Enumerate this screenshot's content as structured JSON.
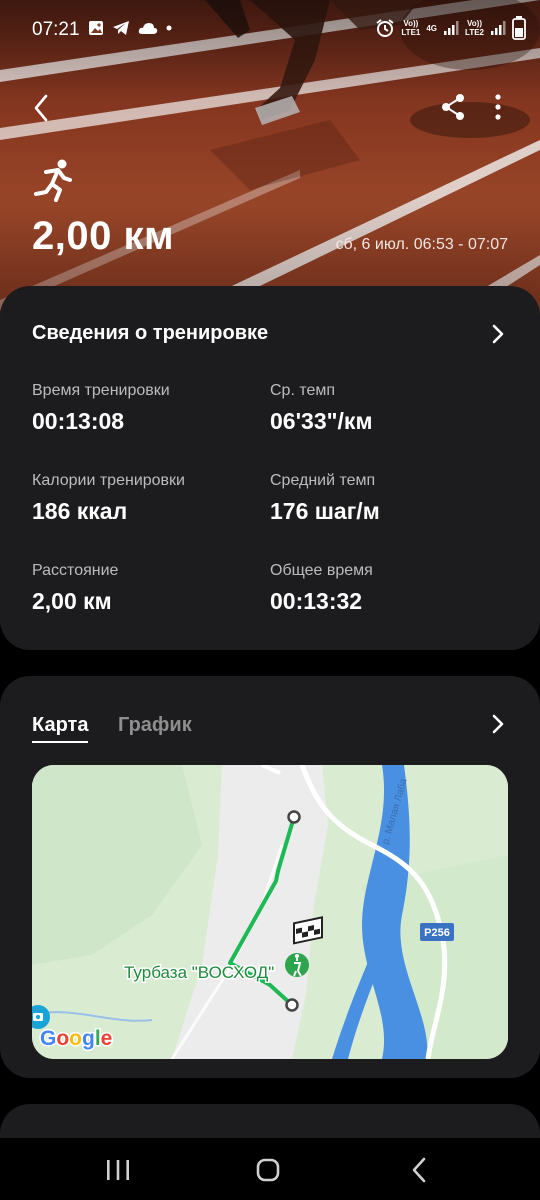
{
  "status_bar": {
    "time": "07:21",
    "left_icons": [
      "image-icon",
      "telegram-icon",
      "cloud-icon",
      "dot-icon"
    ],
    "right_icons": [
      "alarm-icon",
      "signal-lte1-icon",
      "signal-lte2-icon",
      "battery-icon"
    ],
    "sim1_label": "Vo))\nLTE1",
    "sim1_network": "4G",
    "sim2_label": "Vo))\nLTE2"
  },
  "header": {
    "activity_icon": "running-icon",
    "distance": "2,00 км",
    "date_range": "сб, 6 июл. 06:53 - 07:07"
  },
  "details": {
    "title": "Сведения о тренировке",
    "stats": [
      {
        "label": "Время тренировки",
        "value": "00:13:08"
      },
      {
        "label": "Ср. темп",
        "value": "06'33\"/км"
      },
      {
        "label": "Калории тренировки",
        "value": "186 ккал"
      },
      {
        "label": "Средний темп",
        "value": "176 шаг/м"
      },
      {
        "label": "Расстояние",
        "value": "2,00 км"
      },
      {
        "label": "Общее время",
        "value": "00:13:32"
      }
    ]
  },
  "map_card": {
    "tabs": [
      "Карта",
      "График"
    ],
    "active_tab": "Карта",
    "map": {
      "place_label": "Турбаза \"ВОСХОД\"",
      "road_label": "P256",
      "river_label": "р. Малая Лаба",
      "attribution": "Google",
      "route_color": "#1db954",
      "river_color": "#4a90e2"
    }
  },
  "nav_bar": {
    "buttons": [
      "recents-icon",
      "home-icon",
      "back-icon"
    ]
  }
}
